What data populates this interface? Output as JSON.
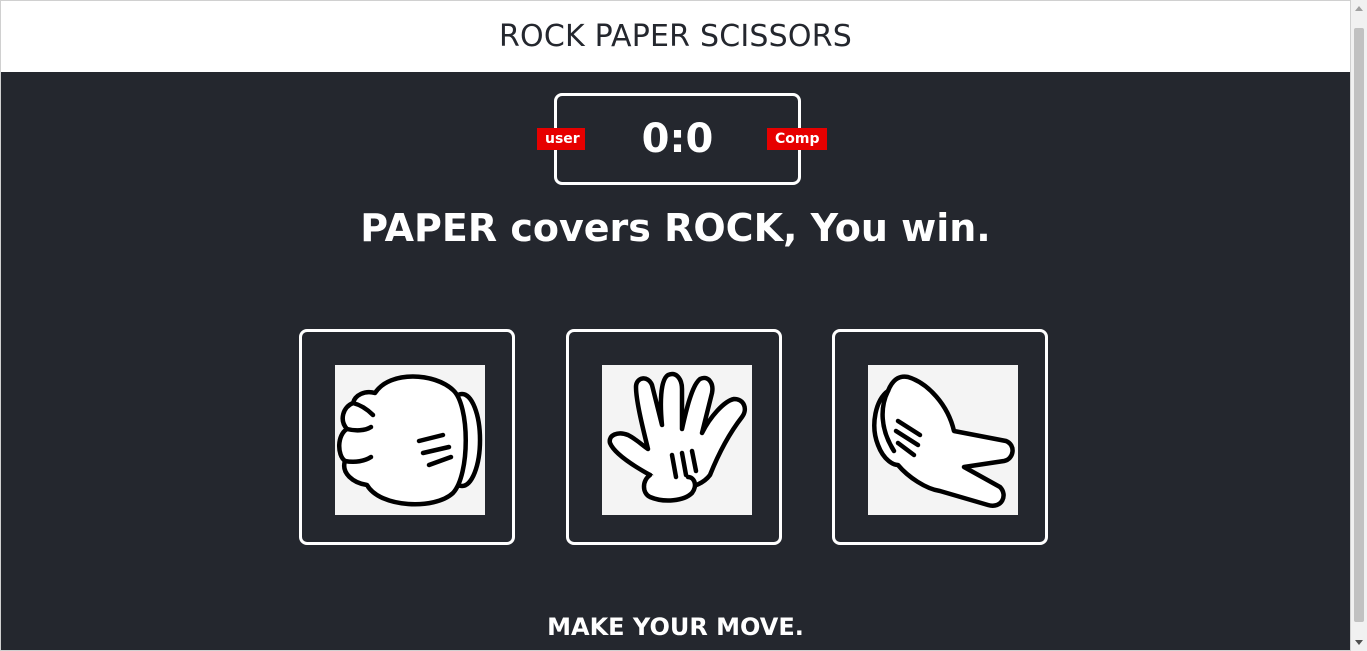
{
  "header": {
    "title": "ROCK PAPER SCISSORS"
  },
  "scoreboard": {
    "score_text": "0:0",
    "user_label": "user",
    "comp_label": "Comp"
  },
  "result_message": "PAPER covers ROCK, You win.",
  "choices": [
    {
      "name": "rock",
      "icon": "rock-hand-icon"
    },
    {
      "name": "paper",
      "icon": "paper-hand-icon"
    },
    {
      "name": "scissors",
      "icon": "scissors-hand-icon"
    }
  ],
  "action_message": "MAKE YOUR MOVE.",
  "colors": {
    "background": "#24272e",
    "badge": "#e60000",
    "border": "#ffffff"
  }
}
